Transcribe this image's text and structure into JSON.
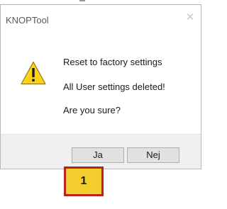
{
  "dialog": {
    "title": "KNOPTool",
    "close_glyph": "✕",
    "icon": "warning-icon",
    "messages": [
      "Reset to factory settings",
      "All User settings deleted!",
      "Are you sure?"
    ],
    "buttons": {
      "yes_label": "Ja",
      "no_label": "Nej"
    }
  },
  "annotation": {
    "badge_number": "1"
  },
  "colors": {
    "warning_fill": "#fcd116",
    "badge_fill": "#f3cc2e",
    "badge_border": "#b8211d"
  }
}
